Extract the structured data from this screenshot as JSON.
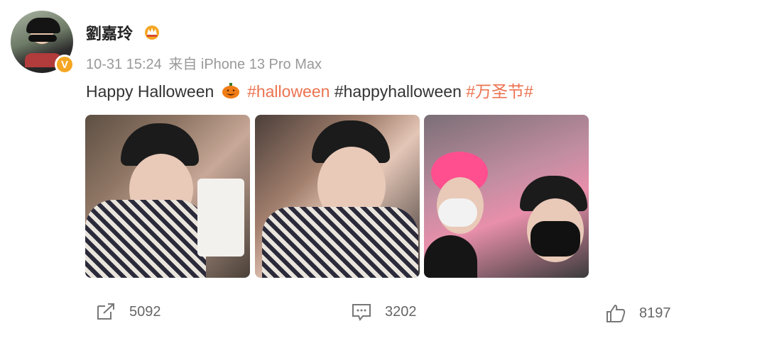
{
  "user": {
    "name": "劉嘉玲",
    "timestamp": "10-31 15:24",
    "source": "来自 iPhone 13 Pro Max",
    "verified_badge": "V"
  },
  "post": {
    "text_prefix": "Happy Halloween",
    "tag1": "#halloween",
    "tag2": "#happyhalloween",
    "tag3": "#万圣节#"
  },
  "images": [
    {
      "subject": "photo-1"
    },
    {
      "subject": "photo-2"
    },
    {
      "subject": "photo-3"
    }
  ],
  "actions": {
    "share_count": "5092",
    "comment_count": "3202",
    "like_count": "8197"
  },
  "colors": {
    "tag": "#eb7350",
    "badge": "#f5a623",
    "meta": "#999999"
  },
  "icons": [
    "crown-icon",
    "pumpkin-icon",
    "share-icon",
    "comment-icon",
    "like-icon"
  ]
}
